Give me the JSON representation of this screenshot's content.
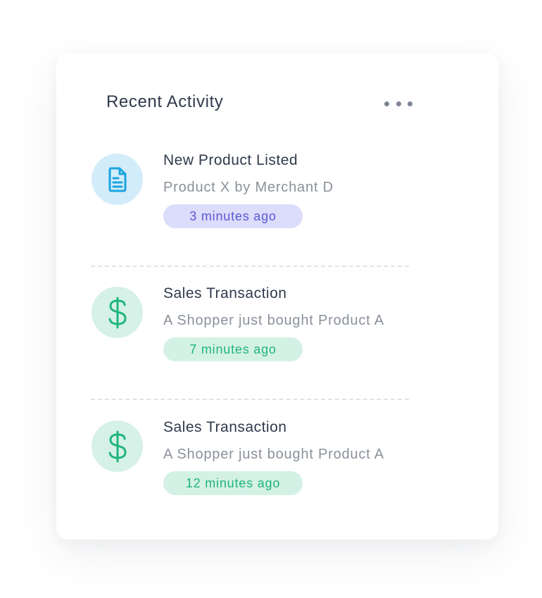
{
  "card": {
    "title": "Recent Activity",
    "more_icon": "ellipsis-icon"
  },
  "activities": [
    {
      "icon": "document-icon",
      "title": "New Product Listed",
      "description": "Product X by Merchant D",
      "time": "3 minutes ago",
      "accent": "#1ba4e0"
    },
    {
      "icon": "dollar-icon",
      "title": "Sales Transaction",
      "description": "A Shopper just bought Product A",
      "time": "7 minutes ago",
      "accent": "#1fb57e"
    },
    {
      "icon": "dollar-icon",
      "title": "Sales Transaction",
      "description": "A Shopper just bought Product A",
      "time": "12 minutes ago",
      "accent": "#1fb57e"
    }
  ]
}
